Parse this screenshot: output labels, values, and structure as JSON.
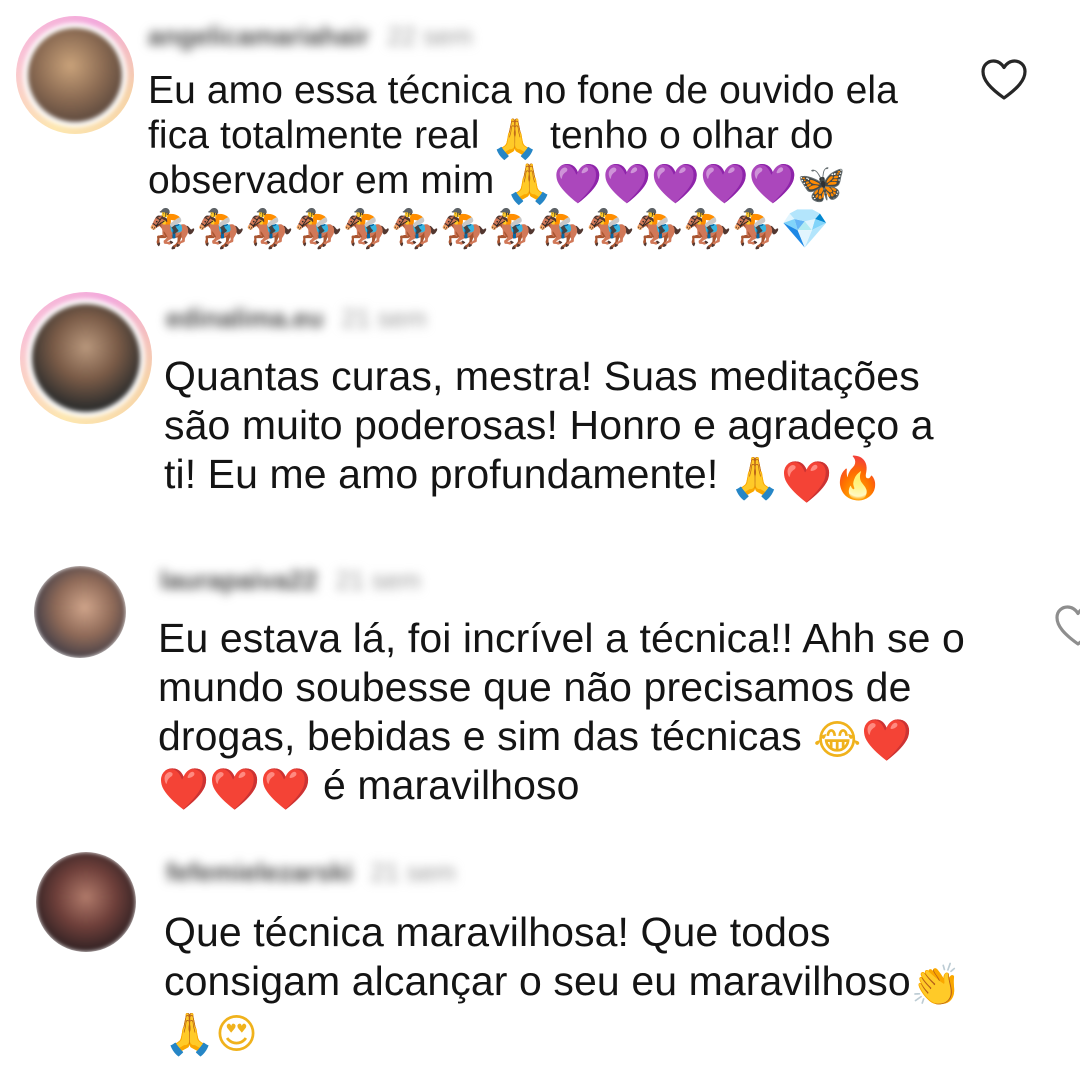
{
  "comments": [
    {
      "username": "angelicamariahair",
      "time": "22 sem",
      "lines": [
        "Eu amo essa técnica no fone de ouvido ela",
        "fica totalmente real 🙏 tenho o olhar do",
        "observador em mim 🙏💜💜💜💜💜🦋",
        "🏇🏇🏇🏇🏇🏇🏇🏇🏇🏇🏇🏇🏇💎"
      ],
      "like_icon": "heart-outline-icon"
    },
    {
      "username": "edinalima.eu",
      "time": "21 sem",
      "lines": [
        "Quantas curas, mestra! Suas meditações",
        "são muito poderosas! Honro e agradeço a",
        "ti! Eu me amo profundamente! 🙏❤️‍🔥"
      ]
    },
    {
      "username": "laurapaiva22",
      "time": "21 sem",
      "lines": [
        "Eu estava lá, foi incrível a técnica!! Ahh se o",
        "mundo soubesse que não precisamos de",
        "drogas, bebidas e sim das técnicas 😂❤️",
        "❤️❤️❤️ é maravilhoso"
      ],
      "like_icon": "heart-outline-icon"
    },
    {
      "username": "fefemielezarski",
      "time": "21 sem",
      "lines": [
        "Que técnica maravilhosa! Que todos",
        "consigam alcançar o seu eu maravilhoso👏",
        "🙏😍"
      ]
    }
  ],
  "colors": {
    "text": "#141414",
    "meta": "#9a9a9a",
    "story_ring": "#f3a9dc"
  }
}
